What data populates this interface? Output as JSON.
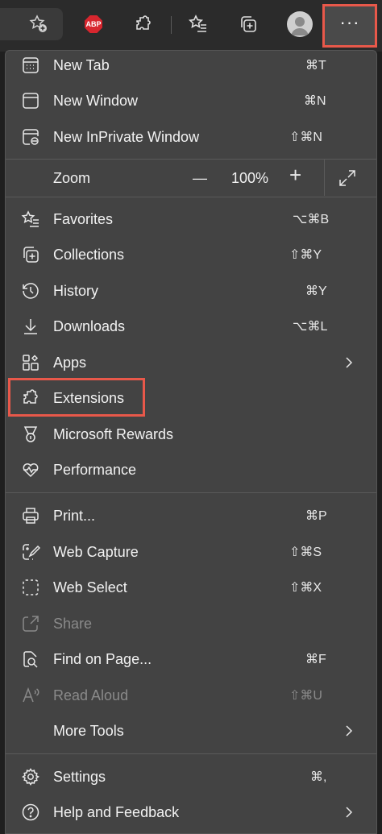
{
  "toolbar": {
    "icons": [
      "star-add-icon",
      "abp-icon",
      "extension-puzzle-icon",
      "favorites-icon",
      "collections-icon",
      "profile-avatar-icon",
      "more-menu-icon"
    ],
    "abp_text": "ABP",
    "more_label": "···"
  },
  "menu": {
    "new_tab": {
      "label": "New Tab",
      "shortcut": "⌘T"
    },
    "new_window": {
      "label": "New Window",
      "shortcut": "⌘N"
    },
    "new_inprivate": {
      "label": "New InPrivate Window",
      "shortcut": "⇧⌘N"
    },
    "zoom": {
      "label": "Zoom",
      "minus": "—",
      "value": "100%",
      "plus": "+"
    },
    "favorites": {
      "label": "Favorites",
      "shortcut": "⌥⌘B"
    },
    "collections": {
      "label": "Collections",
      "shortcut": "⇧⌘Y"
    },
    "history": {
      "label": "History",
      "shortcut": "⌘Y"
    },
    "downloads": {
      "label": "Downloads",
      "shortcut": "⌥⌘L"
    },
    "apps": {
      "label": "Apps"
    },
    "extensions": {
      "label": "Extensions"
    },
    "rewards": {
      "label": "Microsoft Rewards"
    },
    "performance": {
      "label": "Performance"
    },
    "print": {
      "label": "Print...",
      "shortcut": "⌘P"
    },
    "web_capture": {
      "label": "Web Capture",
      "shortcut": "⇧⌘S"
    },
    "web_select": {
      "label": "Web Select",
      "shortcut": "⇧⌘X"
    },
    "share": {
      "label": "Share"
    },
    "find": {
      "label": "Find on Page...",
      "shortcut": "⌘F"
    },
    "read_aloud": {
      "label": "Read Aloud",
      "shortcut": "⇧⌘U"
    },
    "more_tools": {
      "label": "More Tools"
    },
    "settings": {
      "label": "Settings",
      "shortcut": "⌘,"
    },
    "help": {
      "label": "Help and Feedback"
    }
  },
  "colors": {
    "highlight": "#e8584a",
    "menu_bg": "#434343",
    "disabled": "#8a8a8a"
  }
}
